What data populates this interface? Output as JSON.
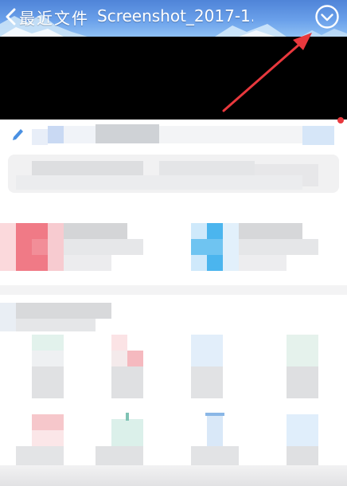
{
  "header": {
    "back_label": "最近文件",
    "title": "Screenshot_2017-1...",
    "icons": [
      "chevron-left-icon",
      "chevron-down-circle-icon"
    ]
  },
  "annotation": {
    "arrow_color": "#e8383d",
    "target": "menu-button"
  },
  "colors": {
    "header_blue": "#5a8fe0",
    "pink": "#f07a86",
    "sky_blue": "#4bb5ee"
  }
}
